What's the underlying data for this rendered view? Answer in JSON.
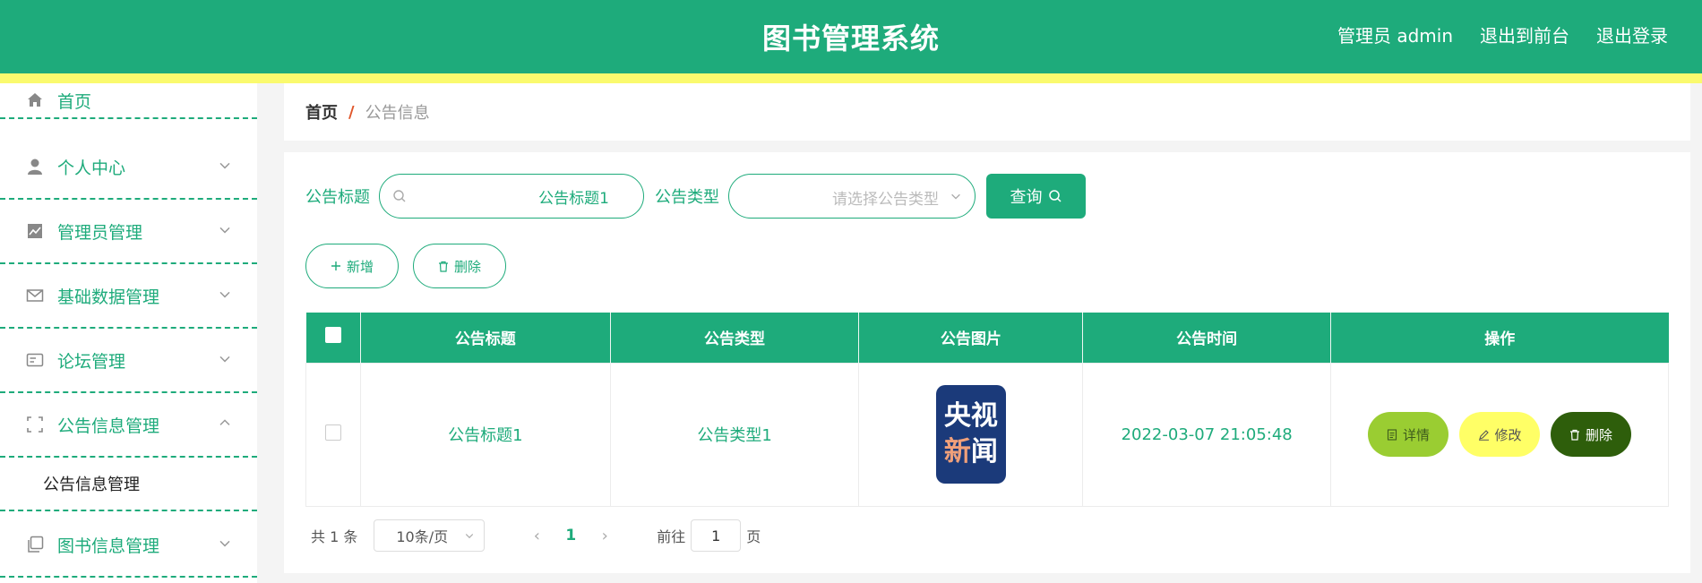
{
  "header": {
    "title": "图书管理系统",
    "user": "管理员 admin",
    "to_front": "退出到前台",
    "logout": "退出登录"
  },
  "sidebar": {
    "items": [
      {
        "label": "首页",
        "icon": "home-icon"
      },
      {
        "label": "个人中心",
        "icon": "user-icon"
      },
      {
        "label": "管理员管理",
        "icon": "chart-icon"
      },
      {
        "label": "基础数据管理",
        "icon": "mail-icon"
      },
      {
        "label": "论坛管理",
        "icon": "card-icon"
      },
      {
        "label": "公告信息管理",
        "icon": "fullscreen-icon"
      },
      {
        "label": "图书信息管理",
        "icon": "copy-icon"
      }
    ],
    "submenu": "公告信息管理"
  },
  "breadcrumb": {
    "home": "首页",
    "sep": "/",
    "current": "公告信息"
  },
  "filters": {
    "title_label": "公告标题",
    "title_value": "公告标题1",
    "type_label": "公告类型",
    "type_placeholder": "请选择公告类型",
    "query": "查询"
  },
  "actions": {
    "add": "新增",
    "delete": "删除"
  },
  "table": {
    "headers": [
      "公告标题",
      "公告类型",
      "公告图片",
      "公告时间",
      "操作"
    ],
    "rows": [
      {
        "title": "公告标题1",
        "type": "公告类型1",
        "image_line1": "央视",
        "image_line2a": "新",
        "image_line2b": "闻",
        "time": "2022-03-07 21:05:48"
      }
    ],
    "ops": {
      "detail": "详情",
      "edit": "修改",
      "delete": "删除"
    }
  },
  "pager": {
    "total": "共 1 条",
    "page_size": "10条/页",
    "current": "1",
    "goto": "前往",
    "goto_value": "1",
    "page_unit": "页"
  },
  "colors": {
    "primary": "#1eab7b",
    "yellow_bar": "#fafa6e",
    "detail": "#9acd32",
    "edit": "#ffff66",
    "delete": "#2e5e0b"
  }
}
